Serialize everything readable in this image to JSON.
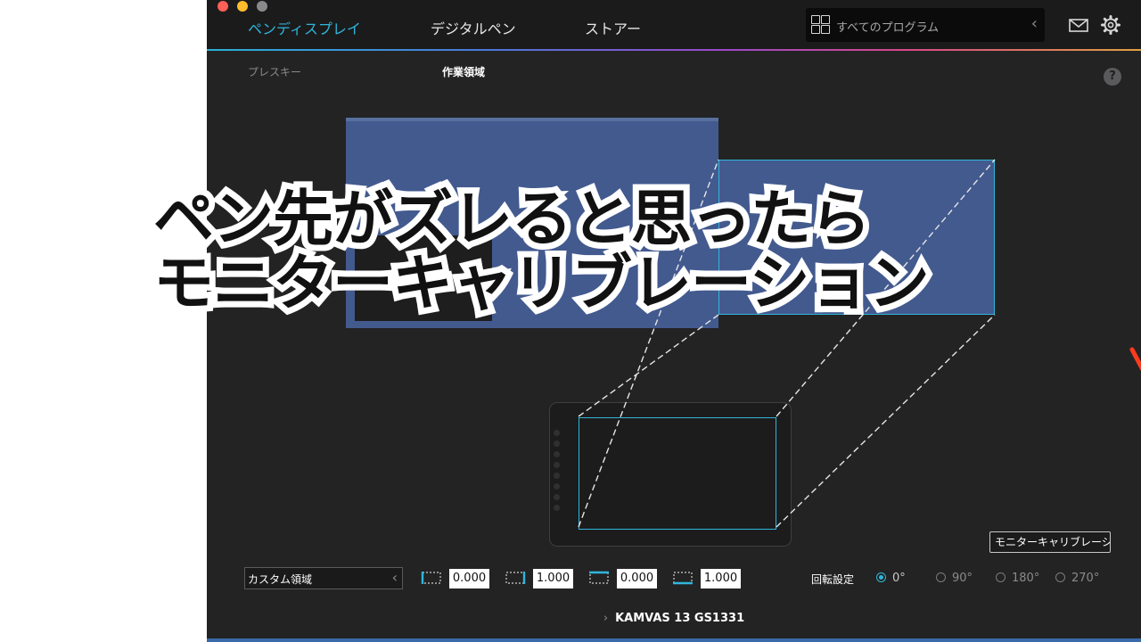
{
  "headline": {
    "line1": "ペン先がズレると思ったら",
    "line2": "モニターキャリブレーション"
  },
  "nav": {
    "tabs": [
      "ペンディスプレイ",
      "デジタルペン",
      "ストアー"
    ],
    "active_tab": "ペンディスプレイ"
  },
  "search": {
    "label": "すべてのプログラム",
    "arrow": "‹"
  },
  "subtabs": [
    "プレスキー",
    "作業領域"
  ],
  "help": "?",
  "calibration_button": "モニターキャリブレーション",
  "area": {
    "select_value": "カスタム領域",
    "select_arrow": "‹",
    "values": [
      "0.000",
      "1.000",
      "0.000",
      "1.000"
    ]
  },
  "rotation": {
    "label": "回転設定",
    "options": [
      "0°",
      "90°",
      "180°",
      "270°"
    ],
    "selected": "0°"
  },
  "device": {
    "chevron": "›",
    "name": "KAMVAS 13 GS1331"
  },
  "colors": {
    "accent": "#2fb6da",
    "monitor_fill": "#435a8f",
    "arrow": "#ff3b1f",
    "background": "#232324"
  }
}
